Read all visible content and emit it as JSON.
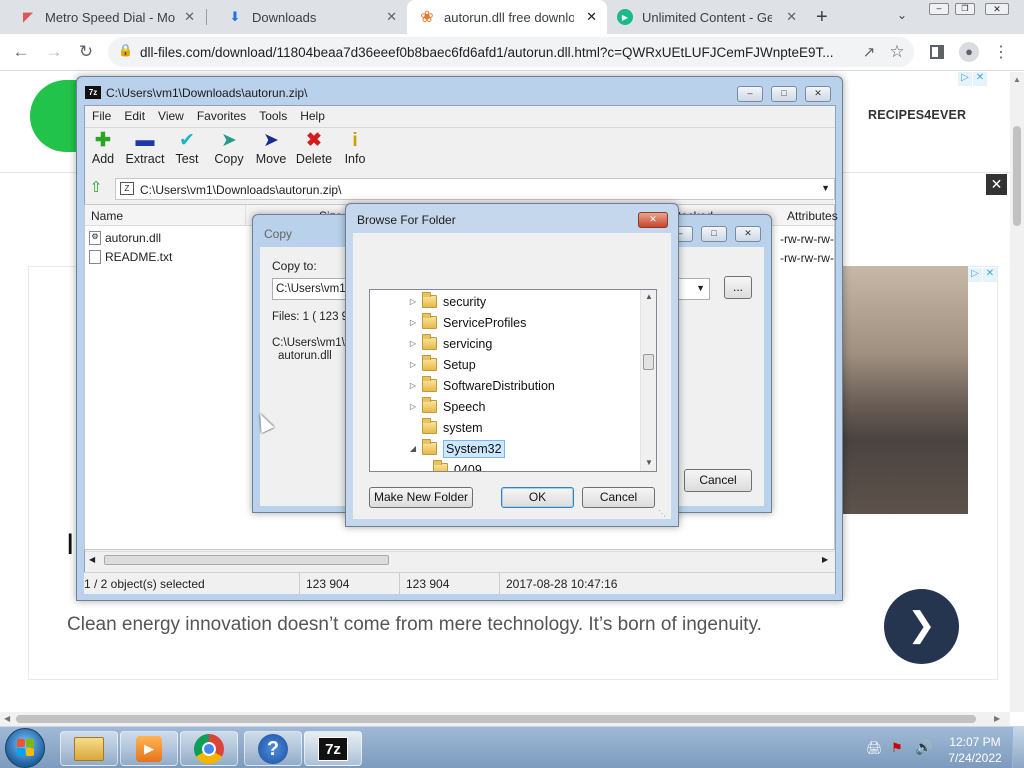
{
  "browser": {
    "tabs": [
      {
        "title": "Metro Speed Dial - Mode",
        "icon": "metro-speed-dial-icon"
      },
      {
        "title": "Downloads",
        "icon": "download-icon"
      },
      {
        "title": "autorun.dll free download",
        "icon": "dll-files-icon",
        "active": true
      },
      {
        "title": "Unlimited Content - Get",
        "icon": "play-icon"
      }
    ],
    "url": "dll-files.com/download/11804beaa7d36eeef0b8baec6fd6afd1/autorun.dll.html?c=QWRxUEtLUFJCemFJWnpteE9T..."
  },
  "page": {
    "ad_brand": "RECIPES4EVER",
    "headline_fragment": "I",
    "tagline": "Clean energy innovation doesn’t come from mere technology. It’s born of ingenuity."
  },
  "sevenzip": {
    "title": "C:\\Users\\vm1\\Downloads\\autorun.zip\\",
    "menu": [
      "File",
      "Edit",
      "View",
      "Favorites",
      "Tools",
      "Help"
    ],
    "tools": [
      {
        "label": "Add",
        "icon": "add-icon"
      },
      {
        "label": "Extract",
        "icon": "extract-icon"
      },
      {
        "label": "Test",
        "icon": "test-icon"
      },
      {
        "label": "Copy",
        "icon": "copy-icon"
      },
      {
        "label": "Move",
        "icon": "move-icon"
      },
      {
        "label": "Delete",
        "icon": "delete-icon"
      },
      {
        "label": "Info",
        "icon": "info-icon"
      }
    ],
    "address": "C:\\Users\\vm1\\Downloads\\autorun.zip\\",
    "columns": {
      "name": "Name",
      "size": "Size",
      "packed": "Packed",
      "attributes": "Attributes"
    },
    "files": [
      {
        "name": "autorun.dll",
        "attributes": "-rw-rw-rw-"
      },
      {
        "name": "README.txt",
        "attributes": "-rw-rw-rw-"
      }
    ],
    "status": {
      "selected": "1 / 2 object(s) selected",
      "size": "123 904",
      "packed": "123 904",
      "modified": "2017-08-28 10:47:16"
    }
  },
  "copy_dialog": {
    "title": "Copy",
    "copy_to_label": "Copy to:",
    "copy_to_value": "C:\\Users\\vm1\\",
    "files_info": "Files: 1    ( 123 9",
    "path_line1": "C:\\Users\\vm1\\",
    "path_line2": "autorun.dll",
    "browse_label": "...",
    "cancel_label": "Cancel"
  },
  "browse_dialog": {
    "title": "Browse For Folder",
    "folders": [
      {
        "name": "security",
        "expand": "collapsed"
      },
      {
        "name": "ServiceProfiles",
        "expand": "collapsed"
      },
      {
        "name": "servicing",
        "expand": "collapsed"
      },
      {
        "name": "Setup",
        "expand": "collapsed"
      },
      {
        "name": "SoftwareDistribution",
        "expand": "collapsed"
      },
      {
        "name": "Speech",
        "expand": "collapsed"
      },
      {
        "name": "system",
        "expand": "none"
      },
      {
        "name": "System32",
        "expand": "expanded",
        "selected": true
      },
      {
        "name": "0409",
        "expand": "none",
        "child": true
      }
    ],
    "make_new_folder": "Make New Folder",
    "ok": "OK",
    "cancel": "Cancel"
  },
  "taskbar": {
    "apps": [
      "file-explorer-icon",
      "media-player-icon",
      "chrome-icon",
      "help-icon",
      "7zip-icon"
    ],
    "sevenzip_label": "7z",
    "clock_time": "12:07 PM",
    "clock_date": "7/24/2022"
  }
}
